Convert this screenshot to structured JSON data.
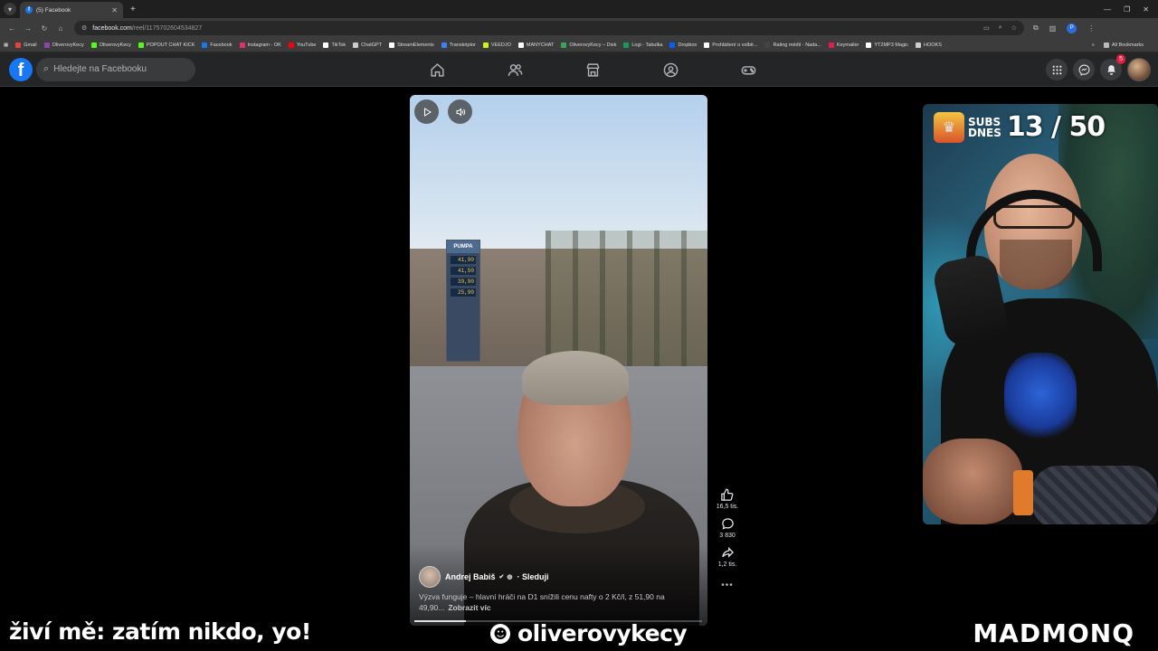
{
  "browser": {
    "tab_title": "(5) Facebook",
    "url_host": "facebook.com",
    "url_path": "/reel/1175702604534827",
    "profile_initial": "P"
  },
  "bookmarks": [
    {
      "label": "Gmail",
      "color": "#ea4335"
    },
    {
      "label": "OliverovyKecy",
      "color": "#8e44ad"
    },
    {
      "label": "OliverovyKecy",
      "color": "#53fc18"
    },
    {
      "label": "POPOUT CHAT KICK",
      "color": "#53fc18"
    },
    {
      "label": "Facebook",
      "color": "#1877f2"
    },
    {
      "label": "Instagram - OK",
      "color": "#e1306c"
    },
    {
      "label": "YouTube",
      "color": "#ff0000"
    },
    {
      "label": "TikTok",
      "color": "#ffffff"
    },
    {
      "label": "ChatGPT",
      "color": "#cccccc"
    },
    {
      "label": "StreamElements",
      "color": "#ffffff"
    },
    {
      "label": "Transkriptor",
      "color": "#3b82f6"
    },
    {
      "label": "VEEDJO",
      "color": "#c9f31d"
    },
    {
      "label": "MANYCHAT",
      "color": "#ffffff"
    },
    {
      "label": "OliverovyKecy – Disk",
      "color": "#34a853"
    },
    {
      "label": "Logi - Tabulka",
      "color": "#0f9d58"
    },
    {
      "label": "Dropbox",
      "color": "#0061ff"
    },
    {
      "label": "Prohlášení o volbě...",
      "color": "#ffffff"
    },
    {
      "label": "Rating médií - Nada...",
      "color": "#444444"
    },
    {
      "label": "Keymailer",
      "color": "#e11d48"
    },
    {
      "label": "YT2MP3 Magic",
      "color": "#ffffff"
    },
    {
      "label": "HOOKS",
      "color": "#cccccc"
    }
  ],
  "bookmarks_all": "All Bookmarks",
  "facebook": {
    "search_placeholder": "Hledejte na Facebooku",
    "notifications_count": "5"
  },
  "reel": {
    "author": "Andrej Babiš",
    "follow_label": "Sleduji",
    "caption": "Výzva funguje – hlavní hráči na D1 snížili cenu nafty o 2 Kč/l, z 51,90 na 49,90...",
    "see_more": "Zobrazit víc",
    "progress": 0.18,
    "station_name": "PUMPA",
    "prices": [
      "41,90",
      "41,50",
      "39,90",
      "25,90"
    ]
  },
  "rail": {
    "likes": "16,5 tis.",
    "comments": "3 830",
    "shares": "1,2 tis."
  },
  "stream": {
    "subs_label_line1": "SUBS",
    "subs_label_line2": "DNES",
    "subs_count": "13 / 50",
    "overlay_left": "živí mě: zatím nikdo, yo!",
    "channel": "oliverovykecy",
    "brand": "MADMONQ"
  }
}
